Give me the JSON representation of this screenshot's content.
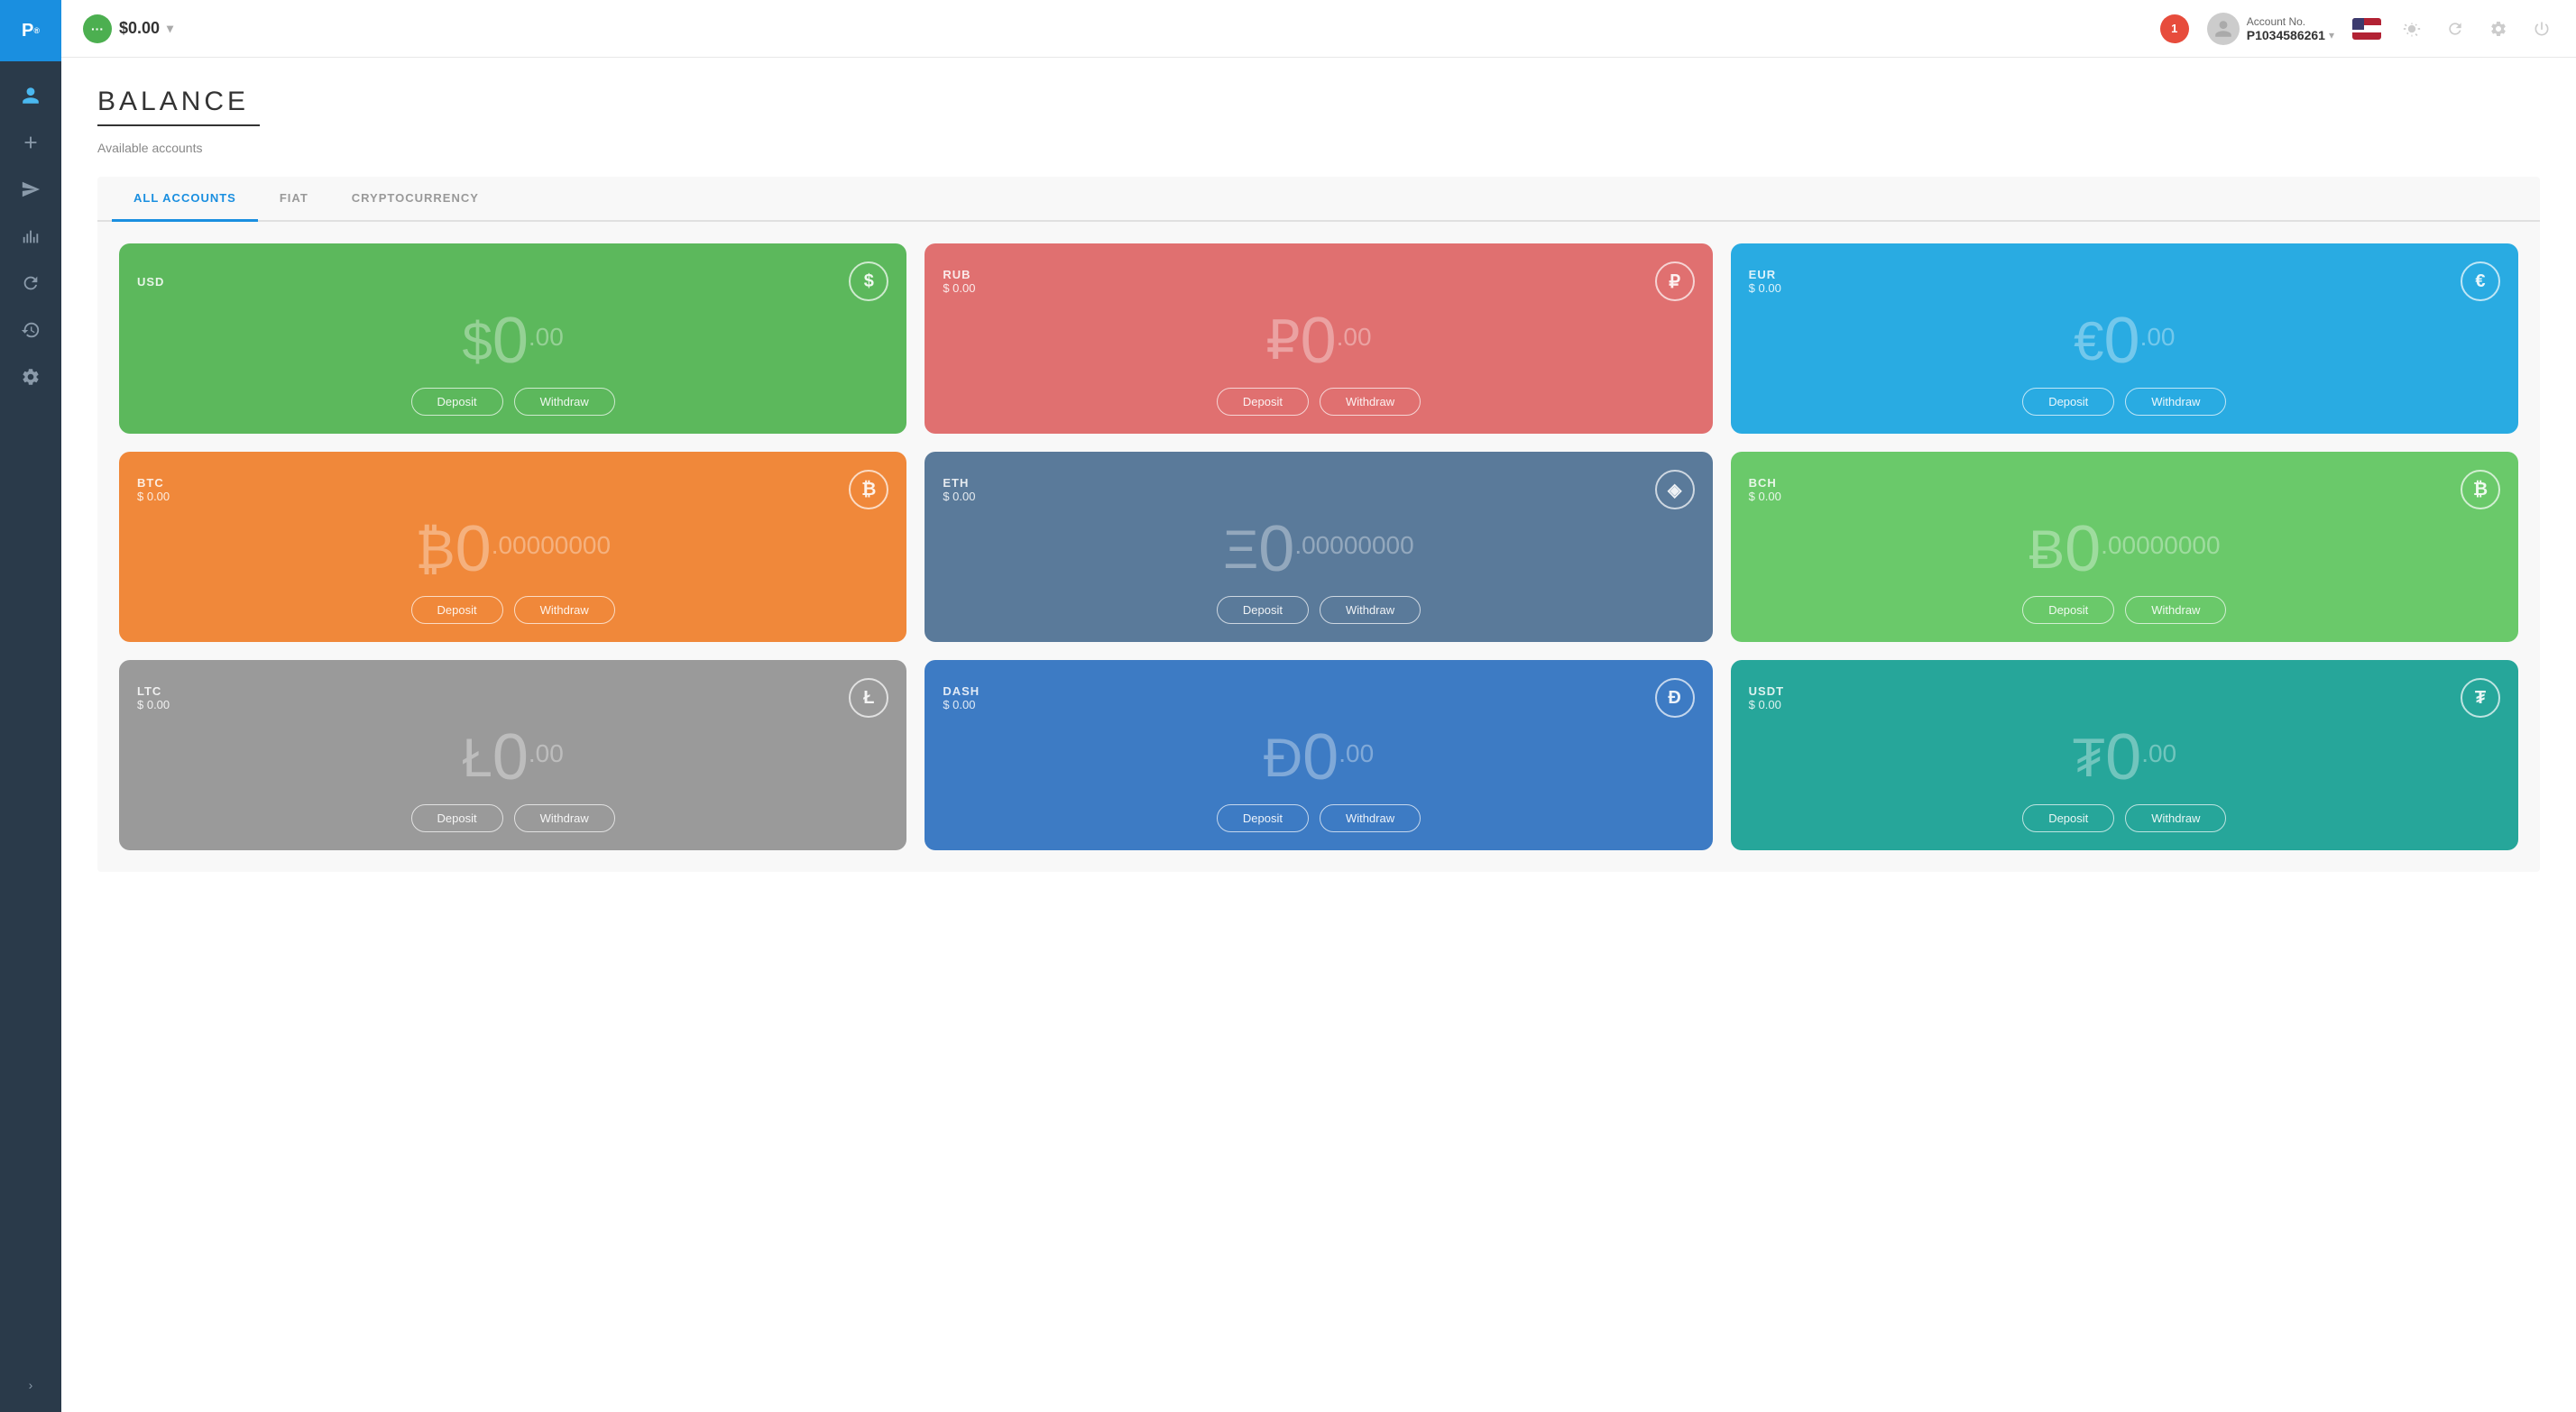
{
  "app": {
    "logo": "P",
    "logoSymbol": "®"
  },
  "topbar": {
    "balance_label": "$0.00",
    "balance_icon": "···",
    "notification_count": "1",
    "account_label": "Account No.",
    "account_id": "P1034586261",
    "chevron": "▾"
  },
  "sidebar": {
    "items": [
      {
        "name": "profile",
        "icon": "👤"
      },
      {
        "name": "add",
        "icon": "+"
      },
      {
        "name": "send",
        "icon": "➤"
      },
      {
        "name": "chart",
        "icon": "📈"
      },
      {
        "name": "refresh",
        "icon": "↻"
      },
      {
        "name": "history",
        "icon": "🕐"
      },
      {
        "name": "settings-gear",
        "icon": "⚙"
      }
    ],
    "expand_icon": "›"
  },
  "page": {
    "title": "BALANCE",
    "subtitle": "Available accounts"
  },
  "tabs": [
    {
      "label": "ALL ACCOUNTS",
      "active": true
    },
    {
      "label": "FIAT",
      "active": false
    },
    {
      "label": "CRYPTOCURRENCY",
      "active": false
    }
  ],
  "cards": [
    {
      "id": "usd",
      "color_class": "card-usd",
      "currency": "USD",
      "usd_value": "",
      "symbol": "$",
      "amount_whole": "0",
      "amount_decimal": ".00",
      "icon_text": "$",
      "deposit_label": "Deposit",
      "withdraw_label": "Withdraw"
    },
    {
      "id": "rub",
      "color_class": "card-rub",
      "currency": "RUB",
      "usd_value": "$ 0.00",
      "symbol": "₽",
      "amount_whole": "0",
      "amount_decimal": ".00",
      "icon_text": "₽",
      "deposit_label": "Deposit",
      "withdraw_label": "Withdraw"
    },
    {
      "id": "eur",
      "color_class": "card-eur",
      "currency": "EUR",
      "usd_value": "$ 0.00",
      "symbol": "€",
      "amount_whole": "0",
      "amount_decimal": ".00",
      "icon_text": "€",
      "deposit_label": "Deposit",
      "withdraw_label": "Withdraw"
    },
    {
      "id": "btc",
      "color_class": "card-btc",
      "currency": "BTC",
      "usd_value": "$ 0.00",
      "symbol": "₿",
      "amount_whole": "0",
      "amount_decimal": ".00000000",
      "icon_text": "₿",
      "deposit_label": "Deposit",
      "withdraw_label": "Withdraw"
    },
    {
      "id": "eth",
      "color_class": "card-eth",
      "currency": "ETH",
      "usd_value": "$ 0.00",
      "symbol": "Ξ",
      "amount_whole": "0",
      "amount_decimal": ".00000000",
      "icon_text": "◈",
      "deposit_label": "Deposit",
      "withdraw_label": "Withdraw"
    },
    {
      "id": "bch",
      "color_class": "card-bch",
      "currency": "BCH",
      "usd_value": "$ 0.00",
      "symbol": "Ƀ",
      "amount_whole": "0",
      "amount_decimal": ".00000000",
      "icon_text": "₿",
      "deposit_label": "Deposit",
      "withdraw_label": "Withdraw"
    },
    {
      "id": "ltc",
      "color_class": "card-ltc",
      "currency": "LTC",
      "usd_value": "$ 0.00",
      "symbol": "Ł",
      "amount_whole": "0",
      "amount_decimal": ".00",
      "icon_text": "Ł",
      "deposit_label": "Deposit",
      "withdraw_label": "Withdraw"
    },
    {
      "id": "dash",
      "color_class": "card-dash",
      "currency": "DASH",
      "usd_value": "$ 0.00",
      "symbol": "Đ",
      "amount_whole": "0",
      "amount_decimal": ".00",
      "icon_text": "Đ",
      "deposit_label": "Deposit",
      "withdraw_label": "Withdraw"
    },
    {
      "id": "usdt",
      "color_class": "card-usdt",
      "currency": "USDT",
      "usd_value": "$ 0.00",
      "symbol": "₮",
      "amount_whole": "0",
      "amount_decimal": ".00",
      "icon_text": "₮",
      "deposit_label": "Deposit",
      "withdraw_label": "Withdraw"
    }
  ]
}
